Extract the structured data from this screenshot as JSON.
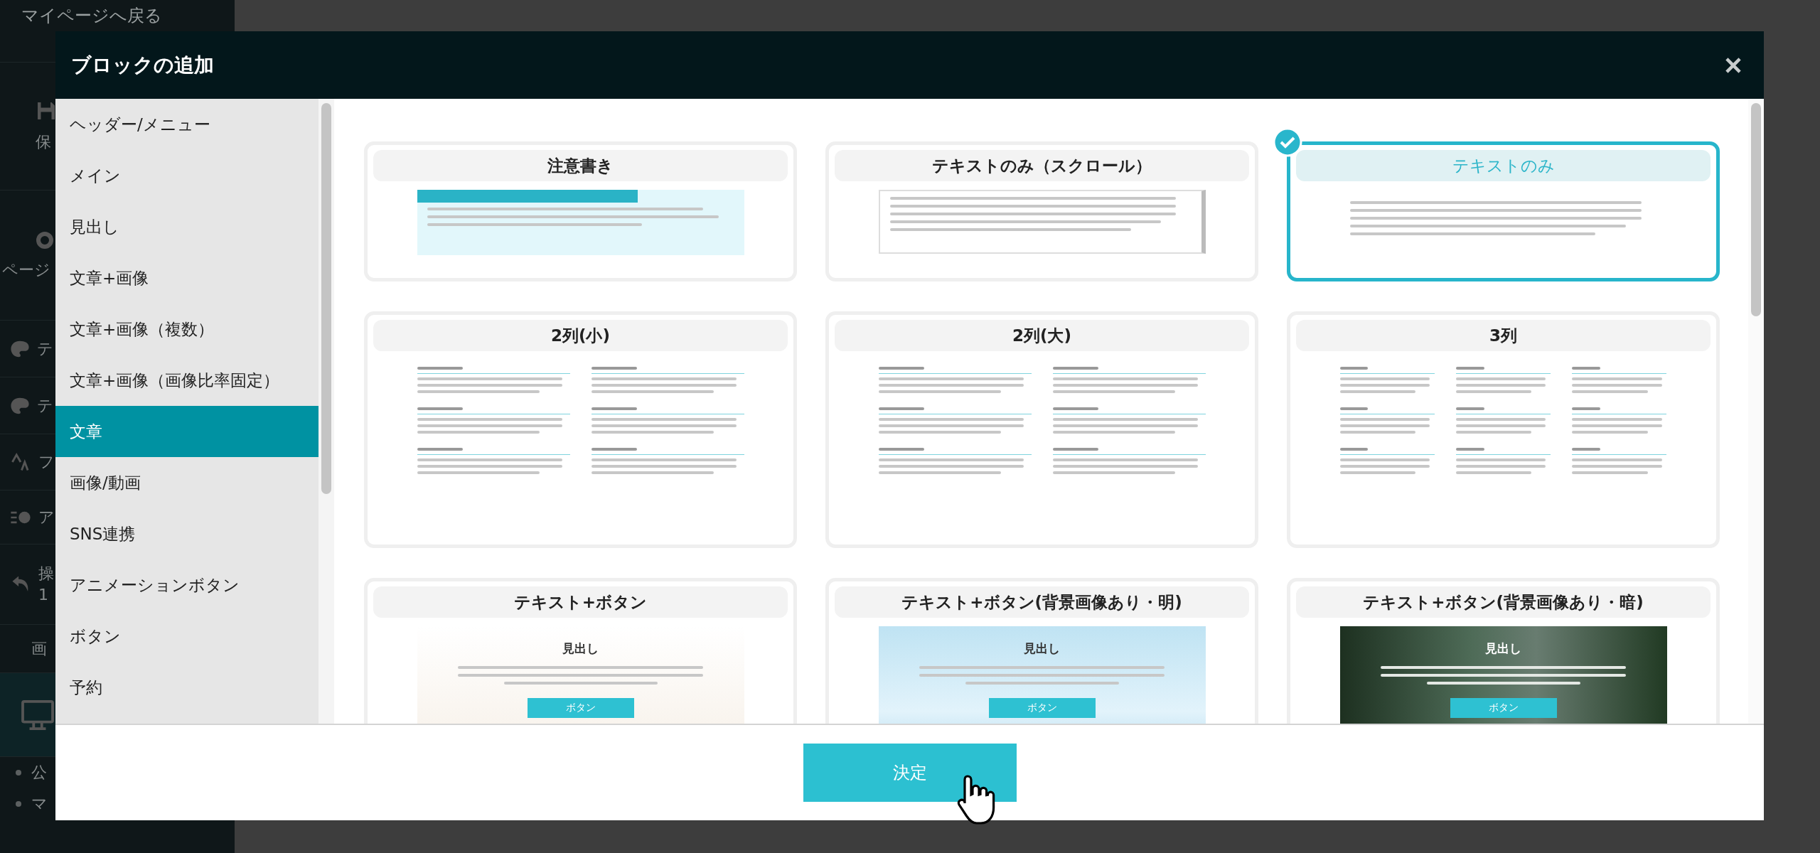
{
  "background": {
    "back_link": "マイページへ戻る",
    "items": [
      {
        "lines": [
          "保"
        ]
      },
      {
        "lines": [
          "ページ"
        ]
      },
      {
        "lines": [
          "テ"
        ]
      },
      {
        "lines": [
          "テ"
        ]
      },
      {
        "lines": [
          "フ"
        ]
      },
      {
        "lines": [
          "ア"
        ]
      },
      {
        "lines": [
          "操",
          "1"
        ]
      },
      {
        "lines": [
          "画"
        ]
      },
      {
        "lines": [
          "公"
        ]
      },
      {
        "lines": [
          "マ"
        ]
      }
    ]
  },
  "modal": {
    "title": "ブロックの追加",
    "categories": [
      {
        "label": "ヘッダー/メニュー",
        "selected": false
      },
      {
        "label": "メイン",
        "selected": false
      },
      {
        "label": "見出し",
        "selected": false
      },
      {
        "label": "文章+画像",
        "selected": false
      },
      {
        "label": "文章+画像（複数）",
        "selected": false
      },
      {
        "label": "文章+画像（画像比率固定）",
        "selected": false
      },
      {
        "label": "文章",
        "selected": true
      },
      {
        "label": "画像/動画",
        "selected": false
      },
      {
        "label": "SNS連携",
        "selected": false
      },
      {
        "label": "アニメーションボタン",
        "selected": false
      },
      {
        "label": "ボタン",
        "selected": false
      },
      {
        "label": "予約",
        "selected": false
      }
    ],
    "blocks": [
      {
        "title": "注意書き",
        "selected": false,
        "kind": "notice"
      },
      {
        "title": "テキストのみ（スクロール）",
        "selected": false,
        "kind": "scroll"
      },
      {
        "title": "テキストのみ",
        "selected": true,
        "kind": "text"
      },
      {
        "title": "2列(小)",
        "selected": false,
        "kind": "cols2s"
      },
      {
        "title": "2列(大)",
        "selected": false,
        "kind": "cols2l"
      },
      {
        "title": "3列",
        "selected": false,
        "kind": "cols3"
      },
      {
        "title": "テキスト+ボタン",
        "selected": false,
        "kind": "btn_plain",
        "heading": "見出し",
        "button": "ボタン"
      },
      {
        "title": "テキスト+ボタン(背景画像あり・明)",
        "selected": false,
        "kind": "btn_light",
        "heading": "見出し",
        "button": "ボタン"
      },
      {
        "title": "テキスト+ボタン(背景画像あり・暗)",
        "selected": false,
        "kind": "btn_dark",
        "heading": "見出し",
        "button": "ボタン"
      }
    ],
    "confirm_button": "決定"
  }
}
